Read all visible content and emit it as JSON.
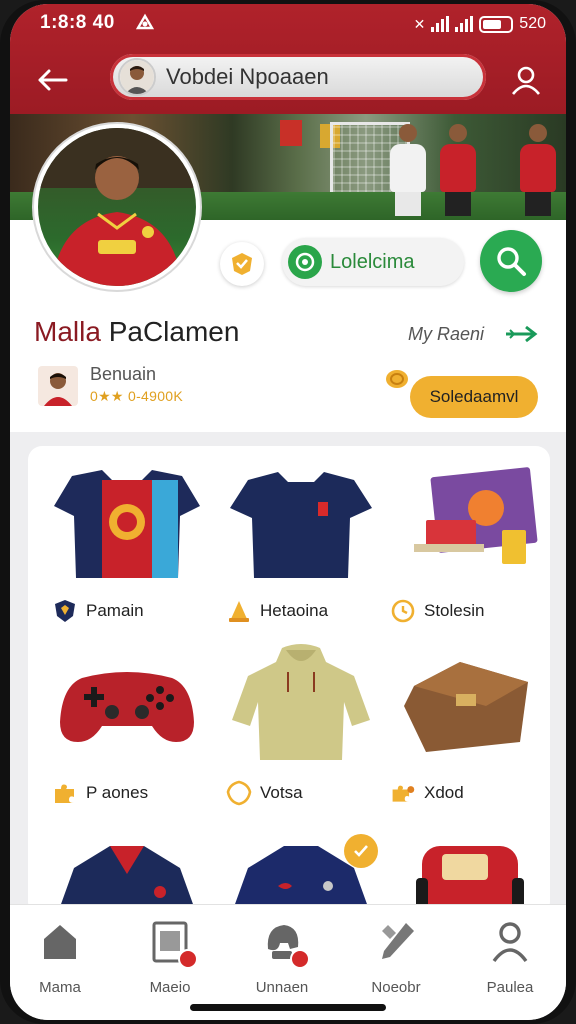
{
  "status_bar": {
    "time": "1:8:8 40",
    "right_text": "520"
  },
  "app_bar": {
    "search_text": "Vobdei Npoaaen"
  },
  "profile": {
    "location_label": "Lolelcima",
    "name_first": "Malla",
    "name_last": "PaClamen",
    "my_link": "My Raeni",
    "sub_name": "Benuain",
    "sub_rating": "0★★ 0-4900K",
    "cta_label": "Soledaamvl"
  },
  "products": [
    {
      "label": "Pamain",
      "icon": "shield-icon"
    },
    {
      "label": "Hetaoina",
      "icon": "cone-icon"
    },
    {
      "label": "Stolesin",
      "icon": "clock-icon"
    },
    {
      "label": "P aones",
      "icon": "puzzle-icon"
    },
    {
      "label": "Votsa",
      "icon": "badge-icon"
    },
    {
      "label": "Xdod",
      "icon": "puzzle-icon"
    }
  ],
  "bottom_nav": [
    {
      "label": "Mama",
      "icon": "home-icon"
    },
    {
      "label": "Maeio",
      "icon": "catalog-icon"
    },
    {
      "label": "Unnaen",
      "icon": "helmet-icon"
    },
    {
      "label": "Noeobr",
      "icon": "tools-icon"
    },
    {
      "label": "Paulea",
      "icon": "person-icon"
    }
  ],
  "colors": {
    "brand_red": "#b0222b",
    "accent_green": "#2aaa52",
    "accent_yellow": "#f0b030"
  }
}
